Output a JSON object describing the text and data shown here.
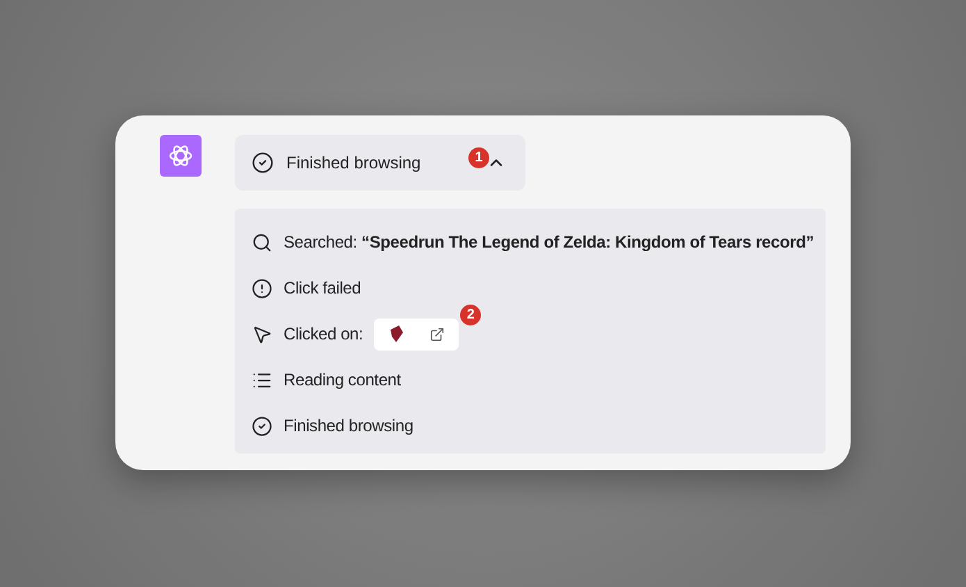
{
  "header": {
    "label": "Finished browsing",
    "expanded": true,
    "badge": "1"
  },
  "steps": [
    {
      "kind": "search",
      "text": "Searched: **“Speedrun The Legend of Zelda: Kingdom of Tears record”**"
    },
    {
      "kind": "error",
      "text": "Click failed"
    },
    {
      "kind": "click",
      "text": "Clicked on:",
      "badge": "2"
    },
    {
      "kind": "reading",
      "text": "Reading content"
    },
    {
      "kind": "done",
      "text": "Finished browsing"
    }
  ]
}
